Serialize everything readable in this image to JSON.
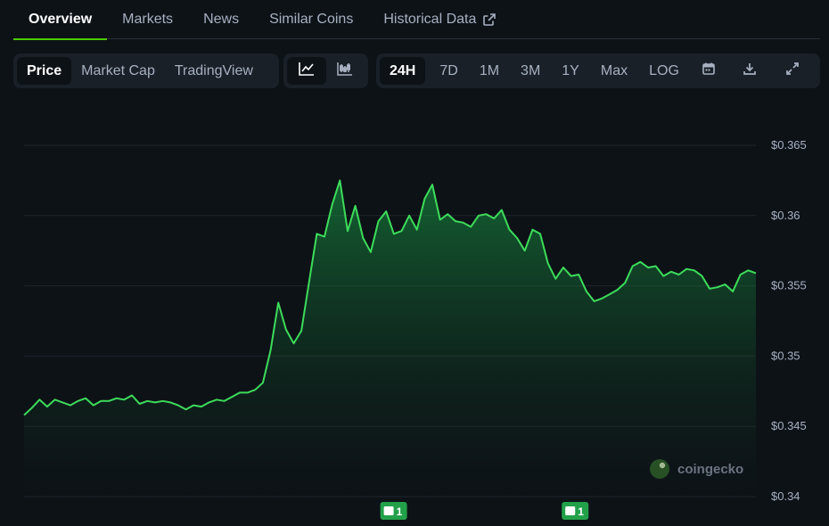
{
  "tabs": [
    {
      "label": "Overview",
      "active": true
    },
    {
      "label": "Markets",
      "active": false
    },
    {
      "label": "News",
      "active": false
    },
    {
      "label": "Similar Coins",
      "active": false
    },
    {
      "label": "Historical Data",
      "active": false,
      "icon": "external-link-icon"
    }
  ],
  "chart_type_tabs": [
    {
      "label": "Price",
      "active": true
    },
    {
      "label": "Market Cap",
      "active": false
    },
    {
      "label": "TradingView",
      "active": false
    }
  ],
  "view_icons": [
    "line-chart-icon",
    "candlestick-chart-icon"
  ],
  "ranges": [
    {
      "label": "24H",
      "active": true
    },
    {
      "label": "7D",
      "active": false
    },
    {
      "label": "1M",
      "active": false
    },
    {
      "label": "3M",
      "active": false
    },
    {
      "label": "1Y",
      "active": false
    },
    {
      "label": "Max",
      "active": false
    },
    {
      "label": "LOG",
      "active": false
    }
  ],
  "tool_icons": [
    "calendar-icon",
    "download-icon",
    "fullscreen-icon"
  ],
  "watermark": "coingecko",
  "colors": {
    "accent": "#4bcc00",
    "line": "#3ddc5a",
    "background": "#0d1217",
    "badge": "#22a14a"
  },
  "news_badges": [
    {
      "count": "1",
      "x_fraction": 0.505
    },
    {
      "count": "1",
      "x_fraction": 0.753
    }
  ],
  "chart_data": {
    "type": "area",
    "ylim": [
      0.34,
      0.365
    ],
    "y_ticks": [
      {
        "value": 0.365,
        "label": "$0.365"
      },
      {
        "value": 0.36,
        "label": "$0.36"
      },
      {
        "value": 0.355,
        "label": "$0.355"
      },
      {
        "value": 0.35,
        "label": "$0.35"
      },
      {
        "value": 0.345,
        "label": "$0.345"
      },
      {
        "value": 0.34,
        "label": "$0.34"
      }
    ],
    "grid": true,
    "values": [
      0.3458,
      0.3463,
      0.3469,
      0.3464,
      0.3469,
      0.3467,
      0.3465,
      0.3468,
      0.347,
      0.3465,
      0.3468,
      0.3468,
      0.347,
      0.3469,
      0.3472,
      0.3466,
      0.3468,
      0.3467,
      0.3468,
      0.3467,
      0.3465,
      0.3462,
      0.3465,
      0.3464,
      0.3467,
      0.3469,
      0.3468,
      0.3471,
      0.3474,
      0.3474,
      0.3476,
      0.3481,
      0.3504,
      0.3538,
      0.3519,
      0.3509,
      0.3518,
      0.3553,
      0.3587,
      0.3585,
      0.3608,
      0.3625,
      0.3589,
      0.3607,
      0.3584,
      0.3574,
      0.3596,
      0.3603,
      0.3587,
      0.3589,
      0.36,
      0.359,
      0.3612,
      0.3622,
      0.3597,
      0.3601,
      0.3596,
      0.3595,
      0.3592,
      0.36,
      0.3601,
      0.3598,
      0.3604,
      0.359,
      0.3584,
      0.3575,
      0.359,
      0.3587,
      0.3566,
      0.3555,
      0.3563,
      0.3557,
      0.3558,
      0.3546,
      0.3539,
      0.3541,
      0.3544,
      0.3547,
      0.3552,
      0.3564,
      0.3567,
      0.3563,
      0.3564,
      0.3557,
      0.356,
      0.3558,
      0.3562,
      0.3561,
      0.3557,
      0.3548,
      0.3549,
      0.3551,
      0.3546,
      0.3558,
      0.3561,
      0.3559
    ]
  }
}
